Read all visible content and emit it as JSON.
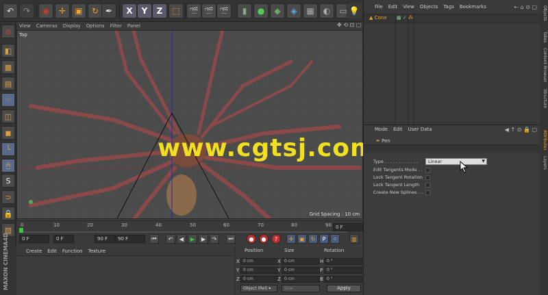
{
  "toolbar": {
    "axis_x": "X",
    "axis_y": "Y",
    "axis_z": "Z"
  },
  "viewport": {
    "menu": [
      "View",
      "Cameras",
      "Display",
      "Options",
      "Filter",
      "Panel"
    ],
    "label": "Top",
    "grid_spacing": "Grid Spacing : 10 cm",
    "watermark": "www.cgtsj.com"
  },
  "timeline": {
    "ticks": [
      "0",
      "10",
      "20",
      "30",
      "40",
      "50",
      "60",
      "70",
      "80",
      "90"
    ],
    "current_frame": "0 F"
  },
  "transport": {
    "start": "0 F",
    "min_field": "0 F",
    "max_field": "90 F",
    "end": "90 F"
  },
  "brand": "MAXON CINEMA4D",
  "materials": {
    "menu": [
      "Create",
      "Edit",
      "Function",
      "Texture"
    ]
  },
  "coordinates": {
    "headers": [
      "Position",
      "Size",
      "Rotation"
    ],
    "axes": [
      "X",
      "Y",
      "Z"
    ],
    "rot_axes": [
      "H",
      "P",
      "B"
    ],
    "position": [
      "0 cm",
      "0 cm",
      "0 cm"
    ],
    "size": [
      "0 cm",
      "0 cm",
      "0 cm"
    ],
    "rotation": [
      "0 °",
      "0 °",
      "0 °"
    ],
    "mode": "Object (Rel) ▾",
    "size_mode": "Size",
    "apply": "Apply"
  },
  "objects": {
    "menu": [
      "File",
      "Edit",
      "View",
      "Objects",
      "Tags",
      "Bookmarks"
    ],
    "items": [
      {
        "name": "Cone"
      }
    ]
  },
  "attributes": {
    "menu": [
      "Mode",
      "Edit",
      "User Data"
    ],
    "object_name": "Pen",
    "type_label": "Type . . . . . . . . . . . .",
    "type_value": "Linear",
    "options": [
      "Edit Tangents Mode . .",
      "Lock Tangent Rotation",
      "Lock Tangent Length",
      "Create New Splines. . ."
    ]
  },
  "right_tabs": [
    "Objects",
    "Takes",
    "Content Browser",
    "Structure",
    "Attributes",
    "Layers"
  ],
  "colors": {
    "accent": "#f0a030",
    "watermark": "#f0e020",
    "bg": "#3c3c3c"
  }
}
